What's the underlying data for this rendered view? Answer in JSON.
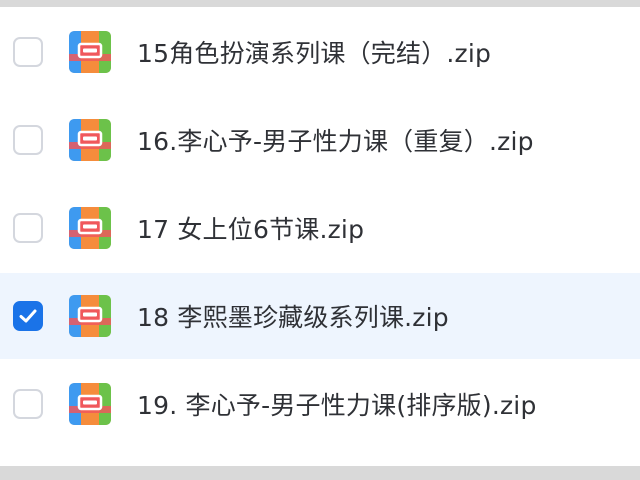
{
  "files": [
    {
      "name": "15角色扮演系列课（完结）.zip",
      "checked": false
    },
    {
      "name": "16.李心予-男子性力课（重复）.zip",
      "checked": false
    },
    {
      "name": "17 女上位6节课.zip",
      "checked": false
    },
    {
      "name": "18 李熙墨珍藏级系列课.zip",
      "checked": true
    },
    {
      "name": "19. 李心予-男子性力课(排序版).zip",
      "checked": false
    }
  ],
  "icon": "zip-archive-icon",
  "colors": {
    "selected_row": "#eef5fe",
    "checkbox_checked": "#1a73e8",
    "icon_orange": "#f58c3c",
    "icon_blue": "#3e9af0",
    "icon_red": "#f0585c",
    "icon_green": "#6cc24a"
  }
}
